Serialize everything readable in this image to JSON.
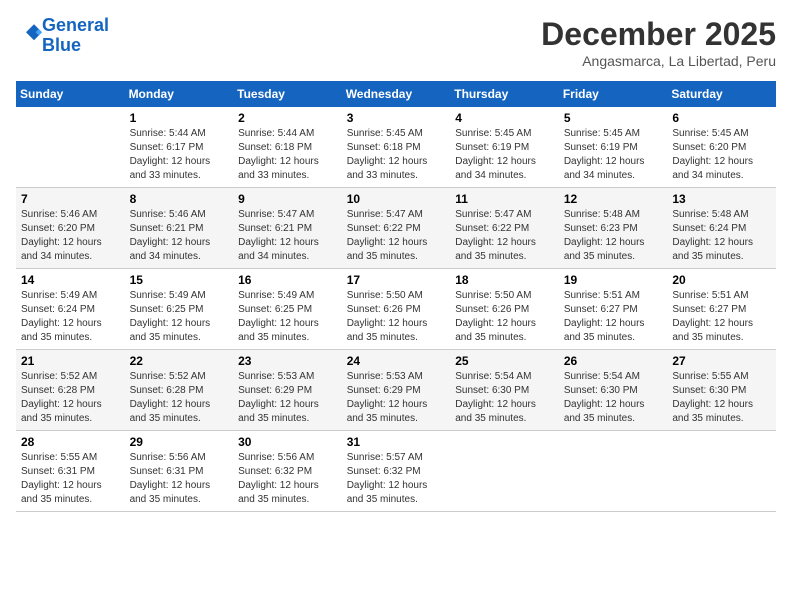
{
  "logo": {
    "line1": "General",
    "line2": "Blue"
  },
  "header": {
    "month": "December 2025",
    "location": "Angasmarca, La Libertad, Peru"
  },
  "days_of_week": [
    "Sunday",
    "Monday",
    "Tuesday",
    "Wednesday",
    "Thursday",
    "Friday",
    "Saturday"
  ],
  "weeks": [
    [
      {
        "day": "",
        "info": ""
      },
      {
        "day": "1",
        "info": "Sunrise: 5:44 AM\nSunset: 6:17 PM\nDaylight: 12 hours\nand 33 minutes."
      },
      {
        "day": "2",
        "info": "Sunrise: 5:44 AM\nSunset: 6:18 PM\nDaylight: 12 hours\nand 33 minutes."
      },
      {
        "day": "3",
        "info": "Sunrise: 5:45 AM\nSunset: 6:18 PM\nDaylight: 12 hours\nand 33 minutes."
      },
      {
        "day": "4",
        "info": "Sunrise: 5:45 AM\nSunset: 6:19 PM\nDaylight: 12 hours\nand 34 minutes."
      },
      {
        "day": "5",
        "info": "Sunrise: 5:45 AM\nSunset: 6:19 PM\nDaylight: 12 hours\nand 34 minutes."
      },
      {
        "day": "6",
        "info": "Sunrise: 5:45 AM\nSunset: 6:20 PM\nDaylight: 12 hours\nand 34 minutes."
      }
    ],
    [
      {
        "day": "7",
        "info": "Sunrise: 5:46 AM\nSunset: 6:20 PM\nDaylight: 12 hours\nand 34 minutes."
      },
      {
        "day": "8",
        "info": "Sunrise: 5:46 AM\nSunset: 6:21 PM\nDaylight: 12 hours\nand 34 minutes."
      },
      {
        "day": "9",
        "info": "Sunrise: 5:47 AM\nSunset: 6:21 PM\nDaylight: 12 hours\nand 34 minutes."
      },
      {
        "day": "10",
        "info": "Sunrise: 5:47 AM\nSunset: 6:22 PM\nDaylight: 12 hours\nand 35 minutes."
      },
      {
        "day": "11",
        "info": "Sunrise: 5:47 AM\nSunset: 6:22 PM\nDaylight: 12 hours\nand 35 minutes."
      },
      {
        "day": "12",
        "info": "Sunrise: 5:48 AM\nSunset: 6:23 PM\nDaylight: 12 hours\nand 35 minutes."
      },
      {
        "day": "13",
        "info": "Sunrise: 5:48 AM\nSunset: 6:24 PM\nDaylight: 12 hours\nand 35 minutes."
      }
    ],
    [
      {
        "day": "14",
        "info": "Sunrise: 5:49 AM\nSunset: 6:24 PM\nDaylight: 12 hours\nand 35 minutes."
      },
      {
        "day": "15",
        "info": "Sunrise: 5:49 AM\nSunset: 6:25 PM\nDaylight: 12 hours\nand 35 minutes."
      },
      {
        "day": "16",
        "info": "Sunrise: 5:49 AM\nSunset: 6:25 PM\nDaylight: 12 hours\nand 35 minutes."
      },
      {
        "day": "17",
        "info": "Sunrise: 5:50 AM\nSunset: 6:26 PM\nDaylight: 12 hours\nand 35 minutes."
      },
      {
        "day": "18",
        "info": "Sunrise: 5:50 AM\nSunset: 6:26 PM\nDaylight: 12 hours\nand 35 minutes."
      },
      {
        "day": "19",
        "info": "Sunrise: 5:51 AM\nSunset: 6:27 PM\nDaylight: 12 hours\nand 35 minutes."
      },
      {
        "day": "20",
        "info": "Sunrise: 5:51 AM\nSunset: 6:27 PM\nDaylight: 12 hours\nand 35 minutes."
      }
    ],
    [
      {
        "day": "21",
        "info": "Sunrise: 5:52 AM\nSunset: 6:28 PM\nDaylight: 12 hours\nand 35 minutes."
      },
      {
        "day": "22",
        "info": "Sunrise: 5:52 AM\nSunset: 6:28 PM\nDaylight: 12 hours\nand 35 minutes."
      },
      {
        "day": "23",
        "info": "Sunrise: 5:53 AM\nSunset: 6:29 PM\nDaylight: 12 hours\nand 35 minutes."
      },
      {
        "day": "24",
        "info": "Sunrise: 5:53 AM\nSunset: 6:29 PM\nDaylight: 12 hours\nand 35 minutes."
      },
      {
        "day": "25",
        "info": "Sunrise: 5:54 AM\nSunset: 6:30 PM\nDaylight: 12 hours\nand 35 minutes."
      },
      {
        "day": "26",
        "info": "Sunrise: 5:54 AM\nSunset: 6:30 PM\nDaylight: 12 hours\nand 35 minutes."
      },
      {
        "day": "27",
        "info": "Sunrise: 5:55 AM\nSunset: 6:30 PM\nDaylight: 12 hours\nand 35 minutes."
      }
    ],
    [
      {
        "day": "28",
        "info": "Sunrise: 5:55 AM\nSunset: 6:31 PM\nDaylight: 12 hours\nand 35 minutes."
      },
      {
        "day": "29",
        "info": "Sunrise: 5:56 AM\nSunset: 6:31 PM\nDaylight: 12 hours\nand 35 minutes."
      },
      {
        "day": "30",
        "info": "Sunrise: 5:56 AM\nSunset: 6:32 PM\nDaylight: 12 hours\nand 35 minutes."
      },
      {
        "day": "31",
        "info": "Sunrise: 5:57 AM\nSunset: 6:32 PM\nDaylight: 12 hours\nand 35 minutes."
      },
      {
        "day": "",
        "info": ""
      },
      {
        "day": "",
        "info": ""
      },
      {
        "day": "",
        "info": ""
      }
    ]
  ]
}
